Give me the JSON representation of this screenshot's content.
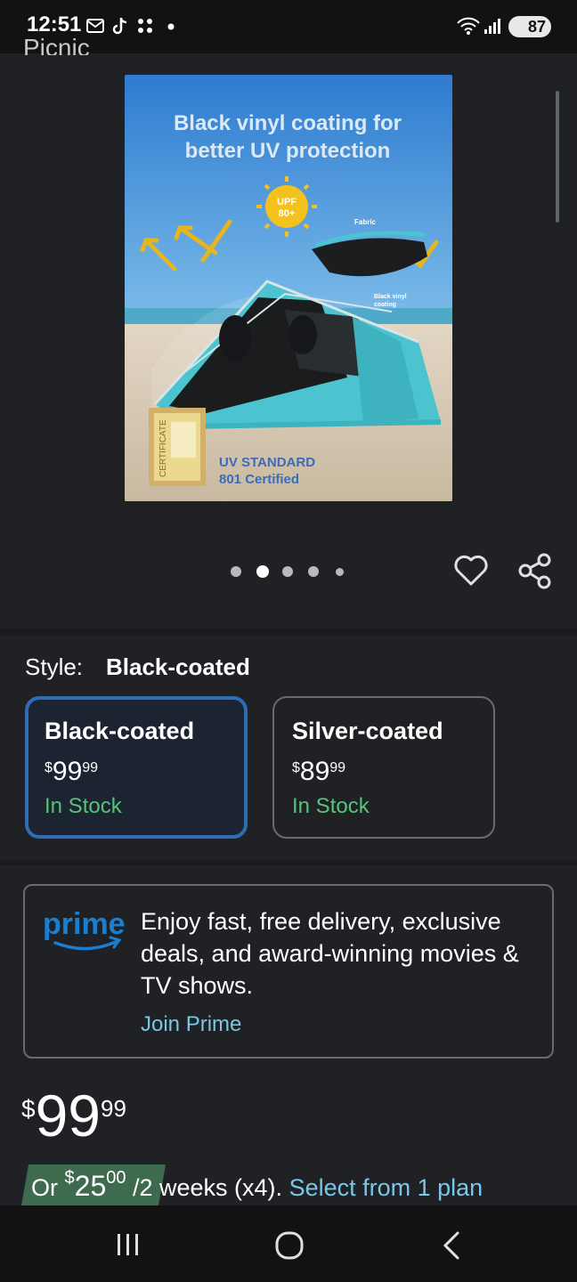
{
  "status_bar": {
    "time": "12:51",
    "battery": "87",
    "left_icons": [
      "gmail-icon",
      "tiktok-icon",
      "app-icon",
      "dot-icon"
    ],
    "right_icons": [
      "wifi-icon",
      "signal-icon"
    ]
  },
  "header": {
    "prev_title": "Picnic"
  },
  "product_image": {
    "headline_line1": "Black vinyl coating for",
    "headline_line2": "better UV protection",
    "sun_badge_line1": "UPF",
    "sun_badge_line2": "80+",
    "fabric_label": "Fabric",
    "coating_label_line1": "Black vinyl",
    "coating_label_line2": "coating",
    "cert_label": "CERTIFICATE",
    "uv_line1": "UV STANDARD",
    "uv_line2": "801 Certified"
  },
  "carousel": {
    "count": 5,
    "active_index": 1
  },
  "style_selector": {
    "label": "Style:",
    "selected_value": "Black-coated",
    "options": [
      {
        "name": "Black-coated",
        "currency": "$",
        "whole": "99",
        "cents": "99",
        "stock": "In Stock",
        "selected": true
      },
      {
        "name": "Silver-coated",
        "currency": "$",
        "whole": "89",
        "cents": "99",
        "stock": "In Stock",
        "selected": false
      }
    ]
  },
  "prime": {
    "logo_text": "prime",
    "message": "Enjoy fast, free delivery, exclusive deals, and award-winning movies & TV shows.",
    "join_label": "Join Prime"
  },
  "price": {
    "currency": "$",
    "whole": "99",
    "cents": "99"
  },
  "installment": {
    "prefix": "Or",
    "currency": "$",
    "whole": "25",
    "cents": "00",
    "terms": "/2 weeks (x4).",
    "link": "Select from 1 plan"
  },
  "colors": {
    "background": "#202124",
    "accent_link": "#79c7e8",
    "selected_border": "#2f6cb5",
    "in_stock": "#57c37a",
    "prime_blue": "#1a7fd1"
  }
}
